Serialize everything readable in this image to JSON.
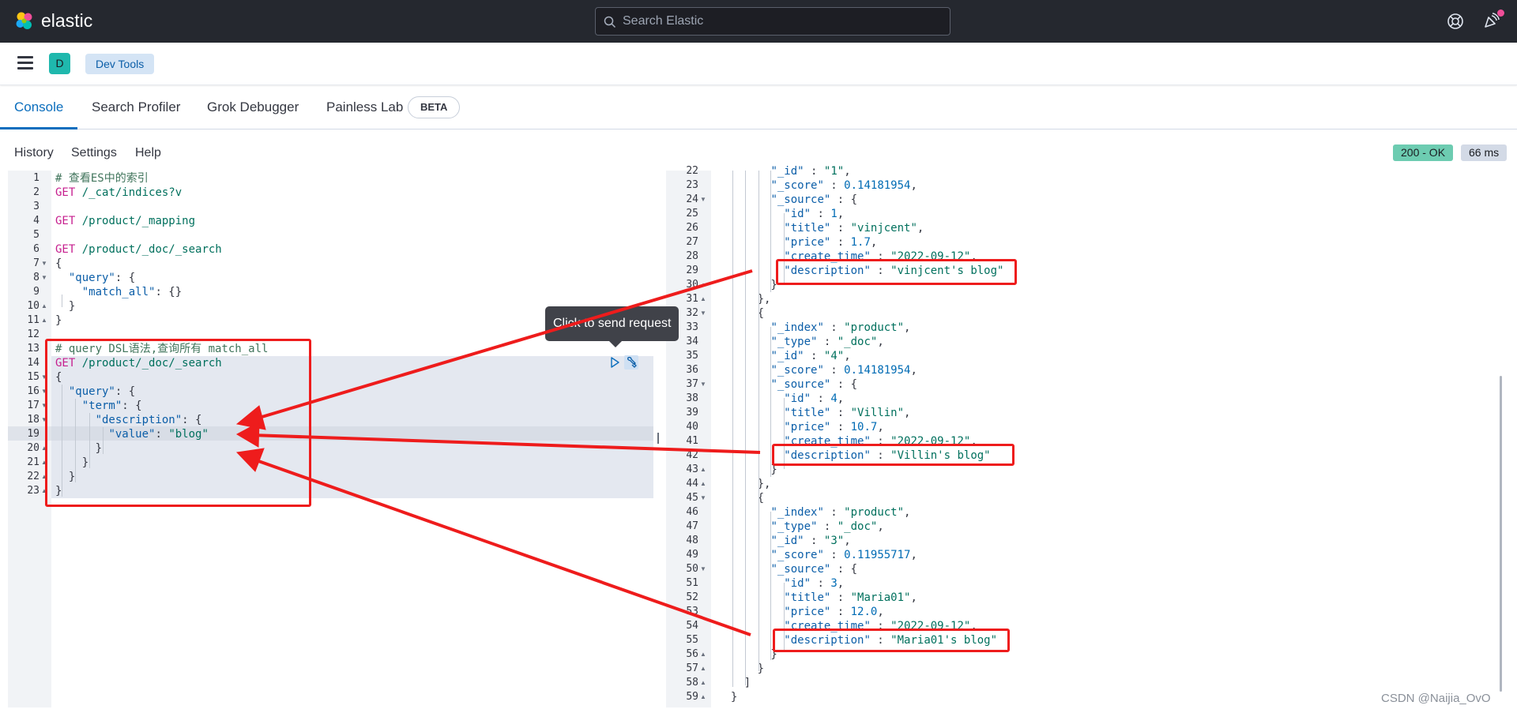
{
  "header": {
    "brand": "elastic",
    "search_placeholder": "Search Elastic"
  },
  "nav": {
    "space_initial": "D",
    "breadcrumb": "Dev Tools"
  },
  "tabs": [
    {
      "label": "Console"
    },
    {
      "label": "Search Profiler"
    },
    {
      "label": "Grok Debugger"
    },
    {
      "label": "Painless Lab"
    }
  ],
  "beta_badge": "BETA",
  "toolbar": {
    "history": "History",
    "settings": "Settings",
    "help": "Help",
    "status": "200 - OK",
    "duration": "66 ms"
  },
  "tooltip": "Click to send request",
  "request_lines": [
    {
      "n": "1",
      "text": "# 查看ES中的索引"
    },
    {
      "n": "2",
      "method": "GET",
      "text": " /_cat/indices?v"
    },
    {
      "n": "3",
      "text": ""
    },
    {
      "n": "4",
      "method": "GET",
      "text": " /product/_mapping"
    },
    {
      "n": "5",
      "text": ""
    },
    {
      "n": "6",
      "method": "GET",
      "text": " /product/_doc/_search"
    },
    {
      "n": "7",
      "text": "{"
    },
    {
      "n": "8",
      "text": "  \"query\": {"
    },
    {
      "n": "9",
      "text": "    \"match_all\": {}"
    },
    {
      "n": "10",
      "text": "  }"
    },
    {
      "n": "11",
      "text": "}"
    },
    {
      "n": "12",
      "text": ""
    },
    {
      "n": "13",
      "text": "# query DSL语法,查询所有 match_all"
    },
    {
      "n": "14",
      "method": "GET",
      "text": " /product/_doc/_search"
    },
    {
      "n": "15",
      "text": "{"
    },
    {
      "n": "16",
      "text": "  \"query\": {"
    },
    {
      "n": "17",
      "text": "    \"term\": {"
    },
    {
      "n": "18",
      "text": "      \"description\": {"
    },
    {
      "n": "19",
      "text": "        \"value\": \"blog\""
    },
    {
      "n": "20",
      "text": "      }"
    },
    {
      "n": "21",
      "text": "    }"
    },
    {
      "n": "22",
      "text": "  }"
    },
    {
      "n": "23",
      "text": "}"
    }
  ],
  "response_lines": [
    {
      "n": "22",
      "text": "        \"_id\" : \"1\","
    },
    {
      "n": "23",
      "text": "        \"_score\" : 0.14181954,"
    },
    {
      "n": "24",
      "text": "        \"_source\" : {"
    },
    {
      "n": "25",
      "text": "          \"id\" : 1,"
    },
    {
      "n": "26",
      "text": "          \"title\" : \"vinjcent\","
    },
    {
      "n": "27",
      "text": "          \"price\" : 1.7,"
    },
    {
      "n": "28",
      "text": "          \"create_time\" : \"2022-09-12\","
    },
    {
      "n": "29",
      "text": "          \"description\" : \"vinjcent's blog\""
    },
    {
      "n": "30",
      "text": "        }"
    },
    {
      "n": "31",
      "text": "      },"
    },
    {
      "n": "32",
      "text": "      {"
    },
    {
      "n": "33",
      "text": "        \"_index\" : \"product\","
    },
    {
      "n": "34",
      "text": "        \"_type\" : \"_doc\","
    },
    {
      "n": "35",
      "text": "        \"_id\" : \"4\","
    },
    {
      "n": "36",
      "text": "        \"_score\" : 0.14181954,"
    },
    {
      "n": "37",
      "text": "        \"_source\" : {"
    },
    {
      "n": "38",
      "text": "          \"id\" : 4,"
    },
    {
      "n": "39",
      "text": "          \"title\" : \"Villin\","
    },
    {
      "n": "40",
      "text": "          \"price\" : 10.7,"
    },
    {
      "n": "41",
      "text": "          \"create_time\" : \"2022-09-12\","
    },
    {
      "n": "42",
      "text": "          \"description\" : \"Villin's blog\""
    },
    {
      "n": "43",
      "text": "        }"
    },
    {
      "n": "44",
      "text": "      },"
    },
    {
      "n": "45",
      "text": "      {"
    },
    {
      "n": "46",
      "text": "        \"_index\" : \"product\","
    },
    {
      "n": "47",
      "text": "        \"_type\" : \"_doc\","
    },
    {
      "n": "48",
      "text": "        \"_id\" : \"3\","
    },
    {
      "n": "49",
      "text": "        \"_score\" : 0.11955717,"
    },
    {
      "n": "50",
      "text": "        \"_source\" : {"
    },
    {
      "n": "51",
      "text": "          \"id\" : 3,"
    },
    {
      "n": "52",
      "text": "          \"title\" : \"Maria01\","
    },
    {
      "n": "53",
      "text": "          \"price\" : 12.0,"
    },
    {
      "n": "54",
      "text": "          \"create_time\" : \"2022-09-12\","
    },
    {
      "n": "55",
      "text": "          \"description\" : \"Maria01's blog\""
    },
    {
      "n": "56",
      "text": "        }"
    },
    {
      "n": "57",
      "text": "      }"
    },
    {
      "n": "58",
      "text": "    ]"
    },
    {
      "n": "59",
      "text": "  }"
    }
  ],
  "watermark": "CSDN @Naijia_OvO",
  "colors": {
    "header_bg": "#25282f",
    "accent": "#0b6ebd",
    "status_ok": "#6dccb1",
    "annotation": "#ee1c1c"
  }
}
